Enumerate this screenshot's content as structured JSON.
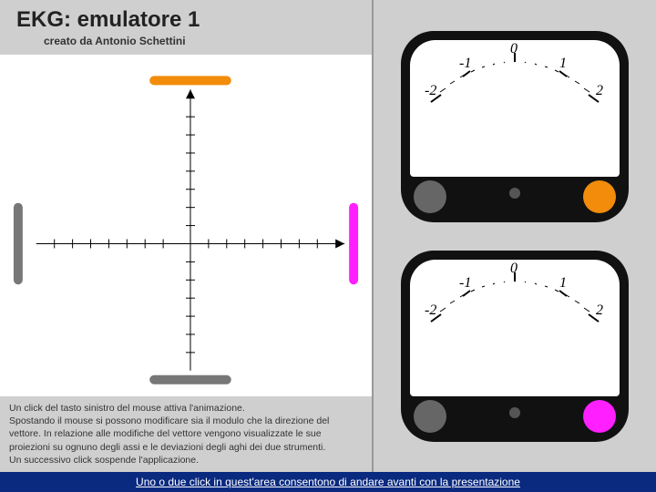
{
  "header": {
    "title": "EKG: emulatore 1",
    "subtitle": "creato da Antonio Schettini"
  },
  "instructions": {
    "line1": "Un click del tasto sinistro del mouse attiva l'animazione.",
    "line2": "Spostando il mouse si possono modificare sia il modulo che la direzione del vettore. In relazione alle modifiche del vettore vengono visualizzate le sue proiezioni su ognuno degli assi e le deviazioni degli aghi dei due strumenti.",
    "line3": "Un successivo click sospende l'applicazione."
  },
  "axes": {
    "electrodes": {
      "top": {
        "color": "#f28c0a"
      },
      "right": {
        "color": "#ff1fff"
      },
      "bottom": {
        "color": "#777"
      },
      "left": {
        "color": "#777"
      }
    }
  },
  "gauges": [
    {
      "scale": [
        "-2",
        "-1",
        "0",
        "1",
        "2"
      ],
      "knob_color": "#f28c0a"
    },
    {
      "scale": [
        "-2",
        "-1",
        "0",
        "1",
        "2"
      ],
      "knob_color": "#ff1fff"
    }
  ],
  "footer": {
    "text": "Uno o due click in quest'area consentono di andare avanti con la presentazione"
  }
}
